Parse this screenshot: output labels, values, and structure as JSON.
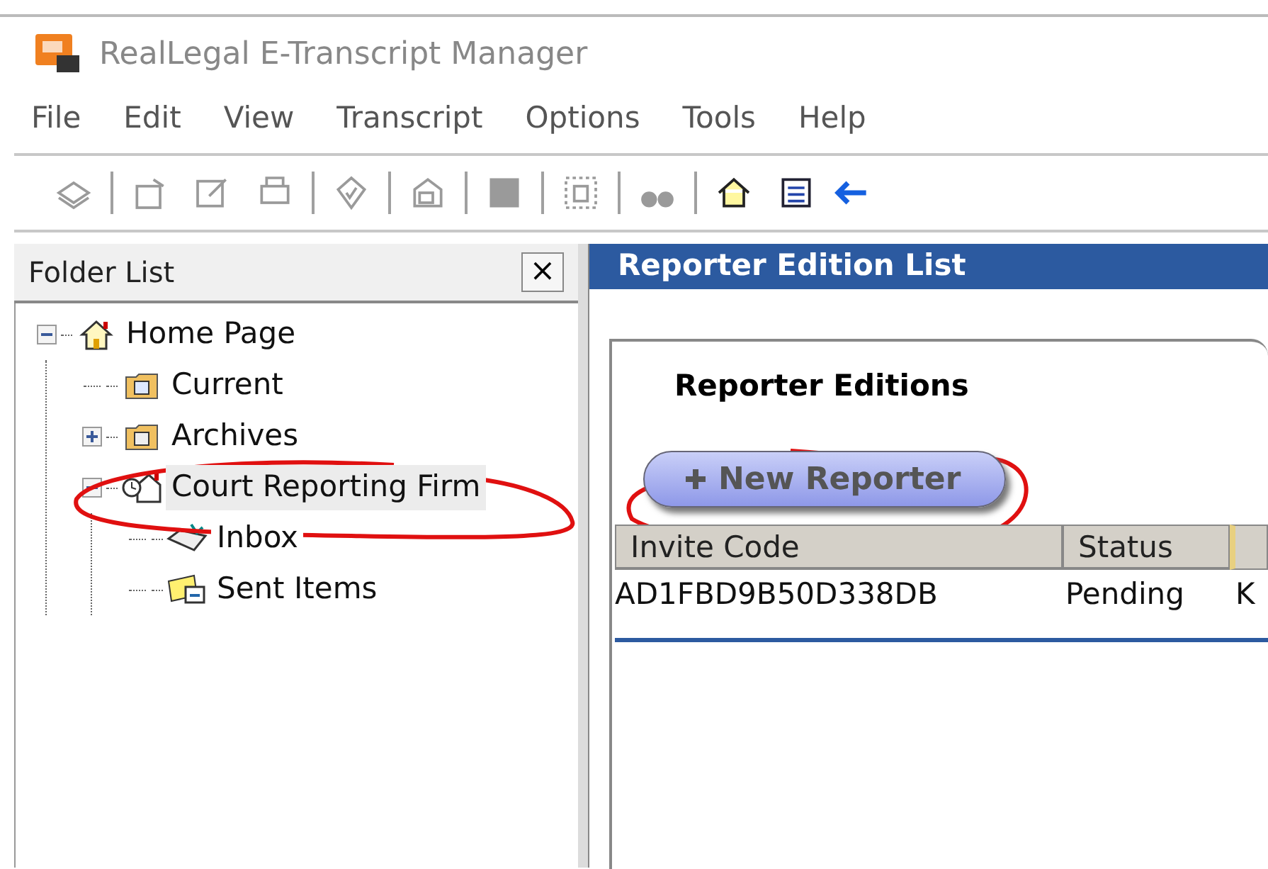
{
  "window": {
    "title": "RealLegal E-Transcript Manager"
  },
  "menu": [
    "File",
    "Edit",
    "View",
    "Transcript",
    "Options",
    "Tools",
    "Help"
  ],
  "folder_pane": {
    "title": "Folder List",
    "close": "×",
    "tree": [
      {
        "label": "Home Page",
        "kind": "home",
        "expanded": true,
        "selected": false,
        "children": [
          {
            "label": "Current",
            "kind": "folder",
            "selected": false
          },
          {
            "label": "Archives",
            "kind": "archive",
            "expanded": false,
            "selected": false
          },
          {
            "label": "Court Reporting Firm",
            "kind": "firm",
            "expanded": true,
            "selected": true,
            "children": [
              {
                "label": "Inbox",
                "kind": "inbox",
                "selected": false
              },
              {
                "label": "Sent Items",
                "kind": "sent",
                "selected": false
              }
            ]
          }
        ]
      }
    ]
  },
  "main": {
    "title": "Reporter Edition List",
    "section_title": "Reporter Editions",
    "new_button": "New Reporter",
    "table": {
      "columns": [
        "Invite Code",
        "Status"
      ],
      "rows": [
        [
          "AD1FBD9B50D338DB",
          "Pending",
          "K"
        ]
      ]
    }
  }
}
